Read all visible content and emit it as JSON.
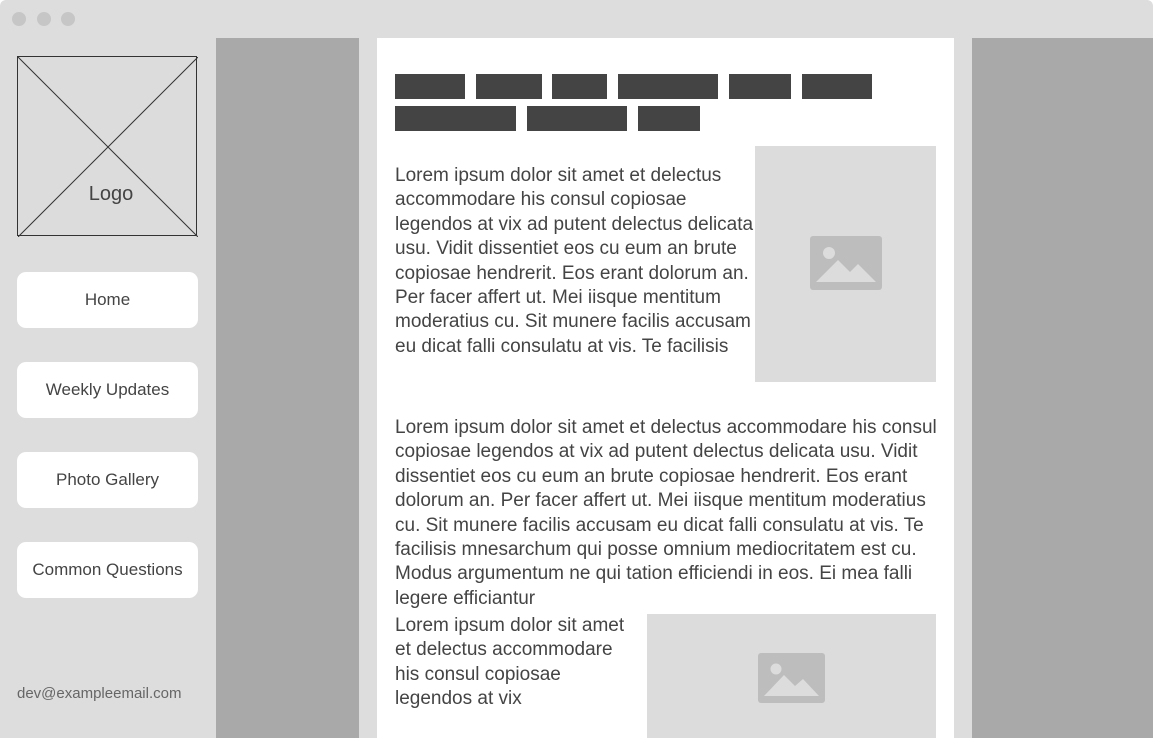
{
  "logo": {
    "label": "Logo"
  },
  "nav": {
    "items": [
      {
        "label": "Home"
      },
      {
        "label": "Weekly Updates"
      },
      {
        "label": "Photo Gallery"
      },
      {
        "label": "Common Questions"
      }
    ]
  },
  "footer": {
    "email": "dev@exampleemail.com"
  },
  "colors": {
    "frame": "#dddddd",
    "gutter": "#a9a9a9",
    "tab": "#444444",
    "text": "#444444",
    "placeholder": "#dcdcdc"
  },
  "content": {
    "paragraph_1": "Lorem ipsum dolor sit amet et delectus accommodare his consul copiosae legendos at vix ad putent delectus delicata usu. Vidit dissentiet eos cu eum an brute copiosae hendrerit. Eos erant dolorum an. Per facer affert ut. Mei iisque mentitum moderatius cu. Sit munere facilis accusam eu dicat falli consulatu at vis. Te facilisis",
    "paragraph_2": "Lorem ipsum dolor sit amet et delectus accommodare his consul copiosae legendos at vix ad putent delectus delicata usu. Vidit dissentiet eos cu eum an brute copiosae hendrerit. Eos erant dolorum an. Per facer affert ut. Mei iisque mentitum moderatius cu. Sit munere facilis accusam eu dicat falli consulatu at vis. Te facilisis mnesarchum qui posse omnium mediocritatem est cu. Modus argumentum ne qui tation efficiendi in eos. Ei mea falli legere efficiantur",
    "paragraph_3": "Lorem ipsum dolor sit amet et delectus accommodare his consul copiosae legendos at vix",
    "image_icon": "image-placeholder-icon"
  }
}
